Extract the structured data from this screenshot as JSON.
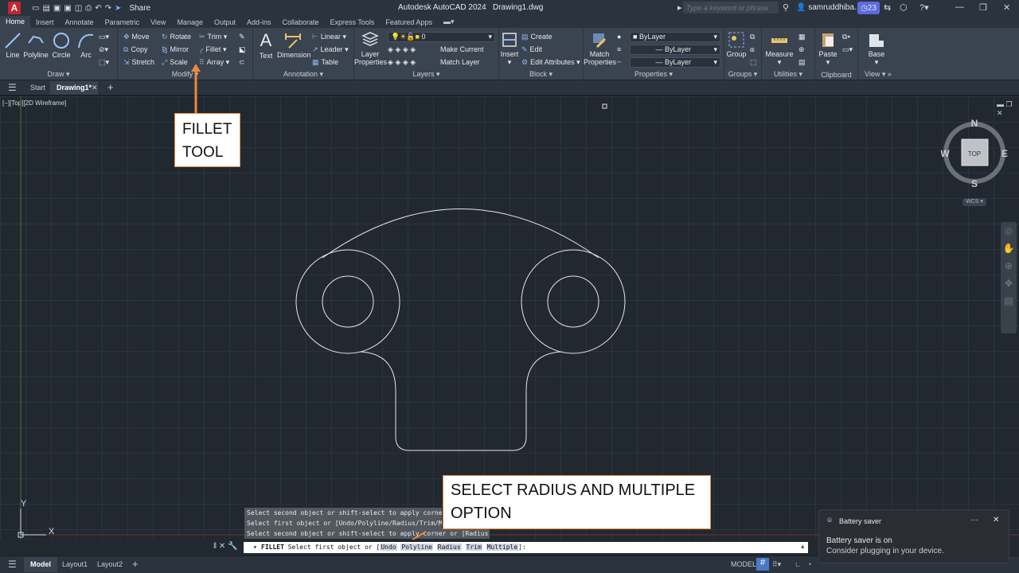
{
  "app": {
    "title": "Autodesk AutoCAD 2024",
    "document": "Drawing1.dwg",
    "share_label": "Share"
  },
  "search": {
    "placeholder": "Type a keyword or phrase"
  },
  "user": {
    "name": "samruddhiba...",
    "badge": "23"
  },
  "ribbon_tabs": [
    "Home",
    "Insert",
    "Annotate",
    "Parametric",
    "View",
    "Manage",
    "Output",
    "Add-ins",
    "Collaborate",
    "Express Tools",
    "Featured Apps"
  ],
  "ribbon": {
    "draw": {
      "label": "Draw",
      "line": "Line",
      "polyline": "Polyline",
      "circle": "Circle",
      "arc": "Arc"
    },
    "modify": {
      "label": "Modify",
      "move": "Move",
      "rotate": "Rotate",
      "trim": "Trim",
      "copy": "Copy",
      "mirror": "Mirror",
      "fillet": "Fillet",
      "stretch": "Stretch",
      "scale": "Scale",
      "array": "Array"
    },
    "annotation": {
      "label": "Annotation",
      "text": "Text",
      "dimension": "Dimension",
      "linear": "Linear",
      "leader": "Leader",
      "table": "Table"
    },
    "layers": {
      "label": "Layers",
      "layer_properties_1": "Layer",
      "layer_properties_2": "Properties",
      "layer_value": "0",
      "make_current": "Make Current",
      "match_layer": "Match Layer"
    },
    "block": {
      "label": "Block",
      "insert": "Insert",
      "create": "Create",
      "edit": "Edit",
      "edit_attributes": "Edit Attributes"
    },
    "properties": {
      "label": "Properties",
      "match_1": "Match",
      "match_2": "Properties",
      "color": "ByLayer",
      "linetype": "ByLayer",
      "lineweight": "ByLayer"
    },
    "groups": {
      "label": "Groups",
      "group": "Group"
    },
    "utilities": {
      "label": "Utilities",
      "measure": "Measure"
    },
    "clipboard": {
      "label": "Clipboard",
      "paste": "Paste"
    },
    "view": {
      "label": "View",
      "base": "Base"
    }
  },
  "file_tabs": {
    "start": "Start",
    "drawing": "Drawing1*"
  },
  "viewport": {
    "label": "[−][Top][2D Wireframe]"
  },
  "viewcube": {
    "n": "N",
    "s": "S",
    "e": "E",
    "w": "W",
    "top": "TOP",
    "wcs": "WCS"
  },
  "ucs": {
    "x": "X",
    "y": "Y"
  },
  "annotations": {
    "fillet_line1": "FILLET",
    "fillet_line2": "TOOL",
    "select_line1": "SELECT RADIUS AND MULTIPLE",
    "select_line2": "OPTION"
  },
  "command_history": [
    "Select second object or shift-select to apply corner",
    "Select first object or [Undo/Polyline/Radius/Trim/Mu",
    "Select second object or shift-select to apply corner or [Radius]:"
  ],
  "command_line": {
    "prefix": "FILLET",
    "prompt": "Select first object or [",
    "opt_undo": "Undo",
    "opt_polyline": "Polyline",
    "opt_radius": "Radius",
    "opt_trim": "Trim",
    "opt_multiple": "Multiple",
    "suffix": "]:"
  },
  "status": {
    "model_tab": "Model",
    "layout1": "Layout1",
    "layout2": "Layout2",
    "mode": "MODEL"
  },
  "toast": {
    "title": "Battery saver",
    "heading": "Battery saver is on",
    "body": "Consider plugging in your device."
  },
  "colors": {
    "accent": "#e98a3c",
    "title_bar": "#2b333d",
    "ribbon": "#3a4350",
    "canvas": "#212830",
    "brand": "#c5252e"
  }
}
